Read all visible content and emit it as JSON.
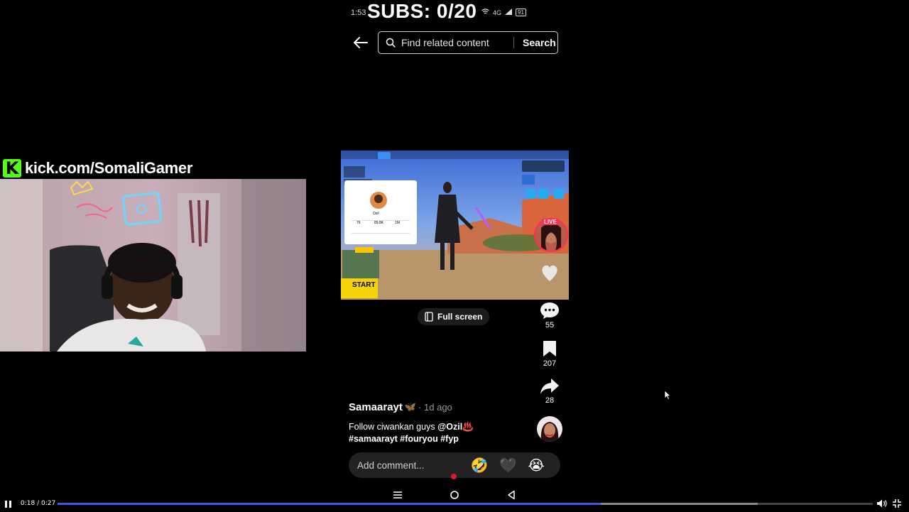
{
  "status_bar": {
    "time": "1:53",
    "battery": "91",
    "network": "4G"
  },
  "overlay": {
    "subs_counter": "SUBS: 0/20",
    "kick_logo_letter": "K",
    "kick_url": "kick.com/SomaliGamer"
  },
  "search": {
    "placeholder": "Find related content",
    "button_label": "Search"
  },
  "video": {
    "fullscreen_label": "Full screen",
    "game_start_label": "START",
    "live_badge": "LIVE"
  },
  "actions": {
    "comments_count": "55",
    "saves_count": "207",
    "shares_count": "28"
  },
  "post": {
    "author": "Samaarayt",
    "author_emoji": "🦋",
    "time_ago": "· 1d ago",
    "caption_text": "Follow ciwankan guys ",
    "mention": "@Ozil",
    "mention_emoji": "♨️",
    "hashtags": "#samaarayt #fouryou #fyp"
  },
  "comment": {
    "placeholder": "Add comment...",
    "emojis": [
      "🤣",
      "🖤",
      "😭"
    ]
  },
  "player": {
    "time_display": "0:18 / 0:27",
    "progress_fraction": 0.6667,
    "buffer_fraction": 0.859,
    "accent_color": "#4a55e0"
  },
  "colors": {
    "kick_green": "#53fc18",
    "record_red": "#e0182d"
  }
}
